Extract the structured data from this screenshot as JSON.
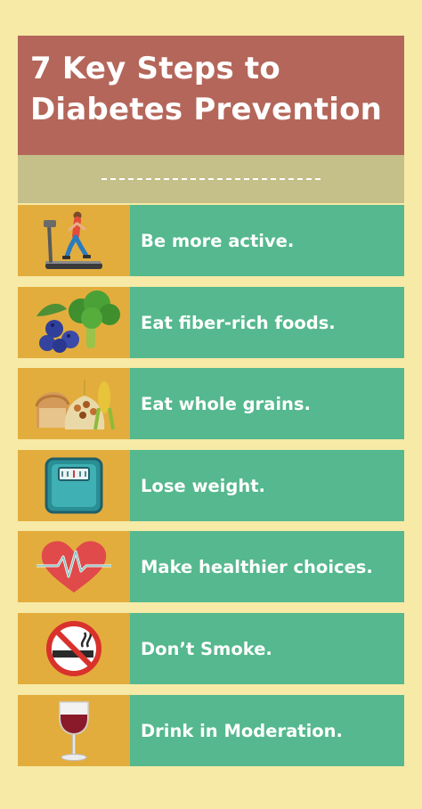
{
  "title": {
    "line1": "7 Key Steps to",
    "line2": "Diabetes Prevention"
  },
  "colors": {
    "background": "#f6eaa6",
    "title_box": "#b4665a",
    "sub_band": "#c5bf89",
    "icon_cell": "#e3ad3d",
    "text_cell": "#55b88e"
  },
  "steps": [
    {
      "label": "Be more active.",
      "icon": "treadmill-icon"
    },
    {
      "label": "Eat fiber-rich foods.",
      "icon": "broccoli-blueberries-icon"
    },
    {
      "label": "Eat whole grains.",
      "icon": "bread-grains-icon"
    },
    {
      "label": "Lose weight.",
      "icon": "scale-icon"
    },
    {
      "label": "Make healthier choices.",
      "icon": "heart-pulse-icon"
    },
    {
      "label": "Don’t Smoke.",
      "icon": "no-smoking-icon"
    },
    {
      "label": "Drink in Moderation.",
      "icon": "wine-glass-icon"
    }
  ]
}
